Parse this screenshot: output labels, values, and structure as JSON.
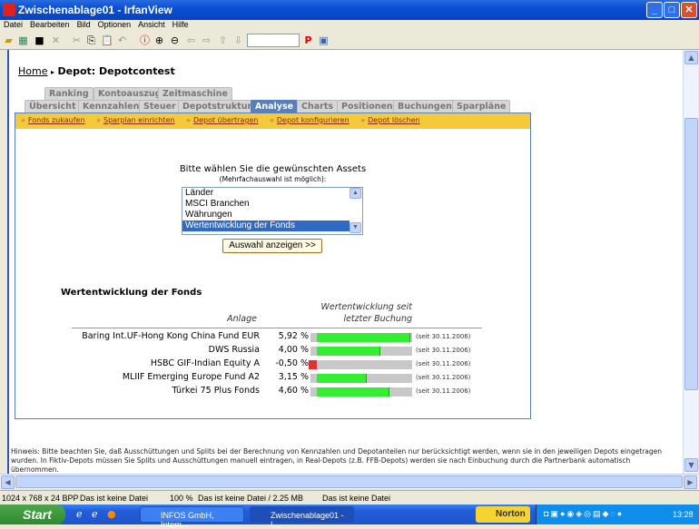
{
  "window": {
    "title": "Zwischenablage01 - IrfanView",
    "menu": [
      "Datei",
      "Bearbeiten",
      "Bild",
      "Optionen",
      "Ansicht",
      "Hilfe"
    ]
  },
  "page": {
    "breadcrumb": {
      "home": "Home",
      "sep": "▸",
      "current": "Depot: Depotcontest"
    },
    "tabs_top": [
      "Ranking",
      "Kontoauszug",
      "Zeitmaschine"
    ],
    "tabs_main": [
      "Übersicht",
      "Kennzahlen",
      "Steuer",
      "Depotstruktur",
      "Analyse",
      "Charts",
      "Positionen",
      "Buchungen",
      "Sparpläne"
    ],
    "active_tab": "Analyse",
    "actions": [
      "Fonds zukaufen",
      "Sparplan einrichten",
      "Depot übertragen",
      "Depot konfigurieren",
      "Depot löschen"
    ],
    "prompt": "Bitte wählen Sie die gewünschten Assets",
    "prompt_hint": "(Mehrfachauswahl ist möglich):",
    "list_options": [
      "Länder",
      "MSCI Branchen",
      "Währungen",
      "Wertentwicklung der Fonds"
    ],
    "selected_option": "Wertentwicklung der Fonds",
    "show_button": "Auswahl anzeigen >>",
    "section_title": "Wertentwicklung der Fonds",
    "col_asset": "Anlage",
    "col_perf_1": "Wertentwicklung seit",
    "col_perf_2": "letzter Buchung",
    "rows": [
      {
        "name": "Baring Int.UF-Hong Kong China Fund EUR",
        "value": "5,92 %",
        "num": 5.92,
        "since": "(seit 30.11.2006)"
      },
      {
        "name": "DWS Russia",
        "value": "4,00 %",
        "num": 4.0,
        "since": "(seit 30.11.2006)"
      },
      {
        "name": "HSBC GIF-Indian Equity A",
        "value": "-0,50 %",
        "num": -0.5,
        "since": "(seit 30.11.2006)"
      },
      {
        "name": "MLIIF Emerging Europe Fund A2",
        "value": "3,15 %",
        "num": 3.15,
        "since": "(seit 30.11.2006)"
      },
      {
        "name": "Türkei 75 Plus Fonds",
        "value": "4,60 %",
        "num": 4.6,
        "since": "(seit 30.11.2006)"
      }
    ],
    "colors": {
      "positive": "#33ee33",
      "negative": "#dd3333"
    },
    "notice": "Hinweis: Bitte beachten Sie, daß Ausschüttungen und Splits bei der Berechnung von Kennzahlen und Depotanteilen nur berücksichtigt werden, wenn sie in den jeweiligen Depots eingetragen wurden. In Fiktiv-Depots müssen Sie Splits und Ausschüttungen manuell eintragen, in Real-Depots (z.B. FFB-Depots) werden sie nach Einbuchung durch die Partnerbank automatisch übernommen."
  },
  "status": {
    "dims": "1024 x 768 x 24 BPP",
    "file1": "Das ist keine Datei",
    "zoom": "100 %",
    "file2": "Das ist keine Datei / 2.25 MB",
    "file3": "Das ist keine Datei"
  },
  "taskbar": {
    "start": "Start",
    "tasks": [
      "INFOS GmbH, Intern...",
      "Zwischenablage01 - I..."
    ],
    "norton": "Norton",
    "clock": "13:28"
  }
}
